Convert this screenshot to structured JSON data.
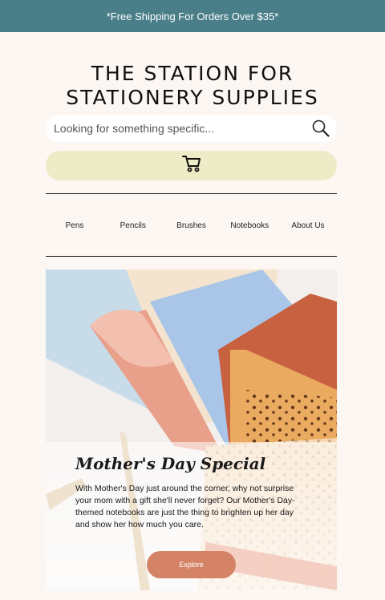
{
  "promo": {
    "text": "*Free Shipping For Orders Over $35*"
  },
  "header": {
    "title": "THE STATION FOR STATIONERY SUPPLIES"
  },
  "search": {
    "placeholder": "Looking for something specific..."
  },
  "icons": {
    "search": "search-icon",
    "cart": "shopping-cart-icon"
  },
  "nav": {
    "items": [
      {
        "label": "Pens"
      },
      {
        "label": "Pencils"
      },
      {
        "label": "Brushes"
      },
      {
        "label": "Notebooks"
      },
      {
        "label": "About Us"
      }
    ]
  },
  "hero": {
    "heading": "Mother's Day Special",
    "body": "With Mother's Day just around the corner, why not surprise your mom with a gift she'll never forget? Our Mother's Day-themed notebooks are just the thing to brighten up her day and show her how much you care.",
    "cta_label": "Explore"
  },
  "colors": {
    "promo_bg": "#4a7f89",
    "page_bg": "#fcf7f3",
    "cart_bg": "#eeebc7",
    "cta_bg": "#d48367"
  }
}
